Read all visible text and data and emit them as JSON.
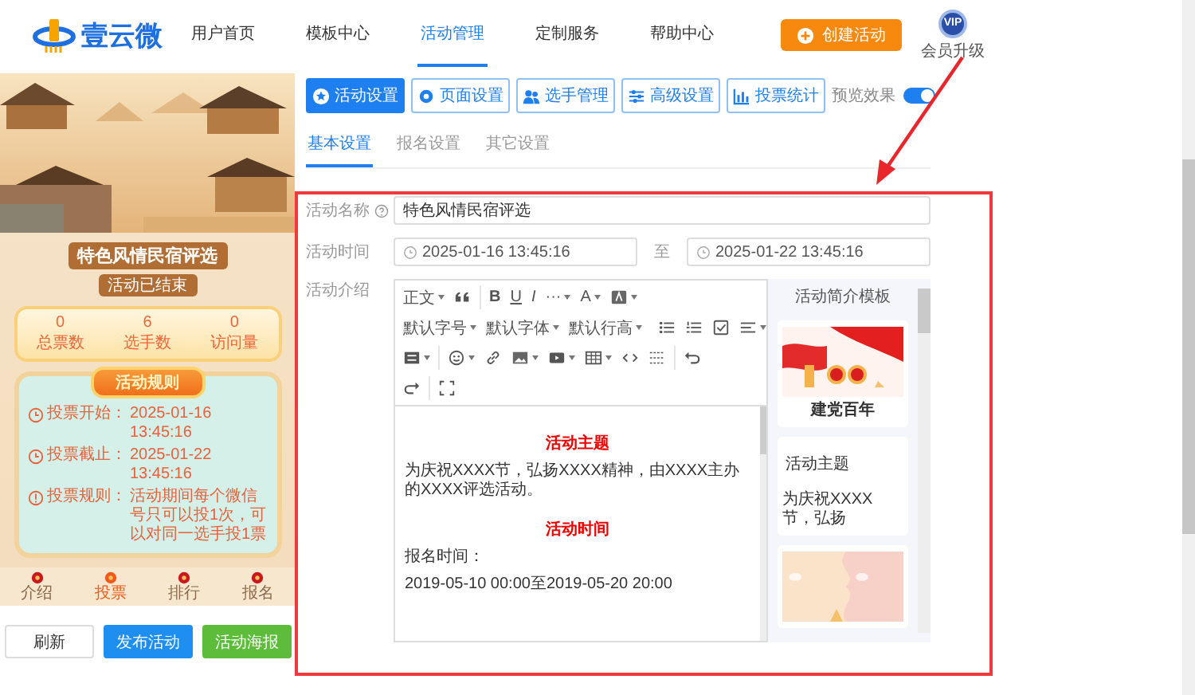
{
  "header": {
    "logo": "壹云微",
    "nav": [
      {
        "label": "用户首页",
        "selected": false
      },
      {
        "label": "模板中心",
        "selected": false
      },
      {
        "label": "活动管理",
        "selected": true
      },
      {
        "label": "定制服务",
        "selected": false
      },
      {
        "label": "帮助中心",
        "selected": false
      }
    ],
    "create_button": "创建活动",
    "vip_badge": "VIP",
    "vip_label": "会员升级"
  },
  "preview": {
    "title": "特色风情民宿评选",
    "status": "活动已结束",
    "stats": [
      {
        "value": "0",
        "label": "总票数"
      },
      {
        "value": "6",
        "label": "选手数"
      },
      {
        "value": "0",
        "label": "访问量"
      }
    ],
    "rules_title": "活动规则",
    "rules": [
      {
        "label": "投票开始：",
        "text": "2025-01-16 13:45:16"
      },
      {
        "label": "投票截止：",
        "text": "2025-01-22 13:45:16"
      },
      {
        "label": "投票规则：",
        "text": "活动期间每个微信号只可以投1次，可以对同一选手投1票"
      }
    ],
    "bottom_nav": [
      {
        "label": "介绍",
        "selected": false
      },
      {
        "label": "投票",
        "selected": true
      },
      {
        "label": "排行",
        "selected": false
      },
      {
        "label": "报名",
        "selected": false
      }
    ]
  },
  "actions": [
    {
      "label": "刷新",
      "kind": "plain"
    },
    {
      "label": "发布活动",
      "kind": "primary"
    },
    {
      "label": "活动海报",
      "kind": "success"
    }
  ],
  "toolbar": [
    {
      "label": "活动设置",
      "selected": true
    },
    {
      "label": "页面设置",
      "selected": false
    },
    {
      "label": "选手管理",
      "selected": false
    },
    {
      "label": "高级设置",
      "selected": false
    },
    {
      "label": "投票统计",
      "selected": false
    }
  ],
  "preview_toggle": {
    "label": "预览效果",
    "on": true
  },
  "tabs": [
    {
      "label": "基本设置",
      "selected": true
    },
    {
      "label": "报名设置",
      "selected": false
    },
    {
      "label": "其它设置",
      "selected": false
    }
  ],
  "form": {
    "name": {
      "label": "活动名称",
      "value": "特色风情民宿评选"
    },
    "time": {
      "label": "活动时间",
      "start": "2025-01-16 13:45:16",
      "separator": "至",
      "end": "2025-01-22 13:45:16"
    },
    "intro": {
      "label": "活动介绍"
    }
  },
  "editor": {
    "toolbar_labels": [
      "正文",
      "B",
      "U",
      "I",
      "···",
      "A",
      "默认字号",
      "默认字体",
      "默认行高"
    ],
    "content": [
      {
        "kind": "heading",
        "text": "活动主题"
      },
      {
        "kind": "paragraph",
        "text": "为庆祝XXXX节，弘扬XXXX精神，由XXXX主办的XXXX评选活动。"
      },
      {
        "kind": "heading",
        "text": "活动时间"
      },
      {
        "kind": "paragraph",
        "text": "报名时间："
      },
      {
        "kind": "paragraph",
        "text": "2019-05-10 00:00至2019-05-20 20:00"
      }
    ]
  },
  "templates": {
    "title": "活动简介模板",
    "items": [
      {
        "kind": "picture",
        "caption": "建党百年"
      },
      {
        "kind": "text",
        "title": "活动主题",
        "text": "为庆祝XXXX节，弘扬"
      },
      {
        "kind": "picture"
      }
    ]
  }
}
